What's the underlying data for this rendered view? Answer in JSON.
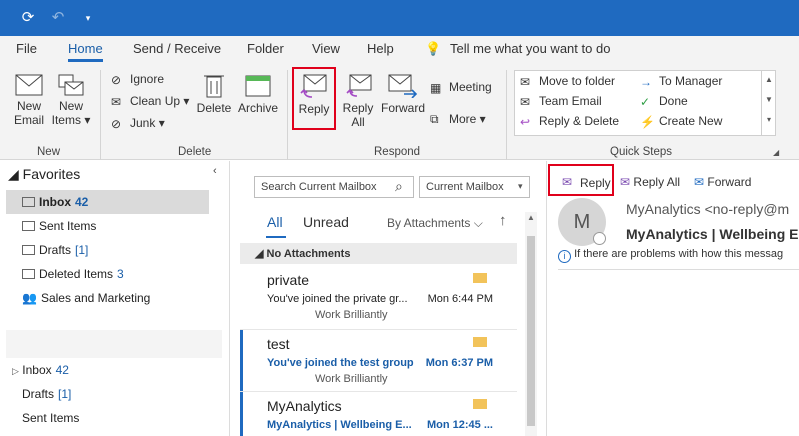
{
  "titlebar": {
    "sync_icon": "sync-icon",
    "undo_icon": "undo-icon",
    "customize_icon": "chevron-down-icon"
  },
  "tabs": [
    "File",
    "Home",
    "Send / Receive",
    "Folder",
    "View",
    "Help"
  ],
  "tell_me": "Tell me what you want to do",
  "ribbon": {
    "new_email": [
      "New",
      "Email"
    ],
    "new_items": [
      "New",
      "Items"
    ],
    "ignore": "Ignore",
    "clean_up": "Clean Up",
    "junk": "Junk",
    "delete": "Delete",
    "archive": "Archive",
    "reply": "Reply",
    "reply_all": [
      "Reply",
      "All"
    ],
    "forward": "Forward",
    "meeting": "Meeting",
    "more": "More",
    "quick_steps": {
      "move_to_folder": "Move to folder",
      "team_email": "Team Email",
      "reply_delete": "Reply & Delete",
      "to_manager": "To Manager",
      "done": "Done",
      "create_new": "Create New"
    },
    "groups": {
      "new": "New",
      "delete": "Delete",
      "respond": "Respond",
      "quick_steps": "Quick Steps"
    }
  },
  "folders": {
    "favorites_label": "Favorites",
    "favorites": [
      {
        "name": "Inbox",
        "count": "42"
      },
      {
        "name": "Sent Items",
        "count": ""
      },
      {
        "name": "Drafts",
        "count": "[1]"
      },
      {
        "name": "Deleted Items",
        "count": "3"
      },
      {
        "name": "Sales and Marketing",
        "count": ""
      }
    ],
    "mailbox": [
      {
        "name": "Inbox",
        "count": "42"
      },
      {
        "name": "Drafts",
        "count": "[1]"
      },
      {
        "name": "Sent Items",
        "count": ""
      }
    ]
  },
  "search": {
    "placeholder": "Search Current Mailbox",
    "scope": "Current Mailbox"
  },
  "filters": {
    "all": "All",
    "unread": "Unread",
    "sort": "By Attachments"
  },
  "group_header": "No Attachments",
  "messages": [
    {
      "from": "private",
      "subject": "You've joined the private gr...",
      "date": "Mon 6:44 PM",
      "preview": "Work Brilliantly",
      "unread": false
    },
    {
      "from": "test",
      "subject": "You've joined the test group",
      "date": "Mon 6:37 PM",
      "preview": "Work Brilliantly",
      "unread": true
    },
    {
      "from": "MyAnalytics",
      "subject": "MyAnalytics | Wellbeing E...",
      "date": "Mon 12:45 ...",
      "preview": "",
      "unread": true
    }
  ],
  "reading": {
    "reply": "Reply",
    "reply_all": "Reply All",
    "forward": "Forward",
    "avatar_letter": "M",
    "sender": "MyAnalytics <no-reply@m",
    "subject": "MyAnalytics | Wellbeing E",
    "info": "If there are problems with how this messag"
  },
  "colors": {
    "accent": "#1f6ac0",
    "highlight": "#e0001b",
    "unread_blue": "#1a5ea8"
  }
}
